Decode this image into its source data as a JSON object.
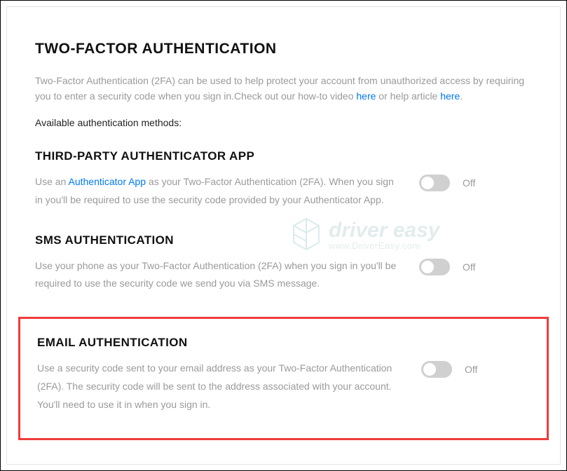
{
  "header": {
    "title": "TWO-FACTOR AUTHENTICATION",
    "intro_part1": "Two-Factor Authentication (2FA) can be used to help protect your account from unauthorized access by requiring you to enter a security code when you sign in.Check out our how-to video ",
    "link_here_1": "here",
    "intro_part2": " or help article ",
    "link_here_2": "here",
    "intro_part3": ".",
    "available": "Available authentication methods:"
  },
  "sections": {
    "authenticator": {
      "title": "THIRD-PARTY AUTHENTICATOR APP",
      "desc_pre": "Use an ",
      "desc_link": "Authenticator App",
      "desc_post": " as your Two-Factor Authentication (2FA). When you sign in you'll be required to use the security code provided by your Authenticator App.",
      "toggle_state": "Off"
    },
    "sms": {
      "title": "SMS AUTHENTICATION",
      "desc": "Use your phone as your Two-Factor Authentication (2FA) when you sign in you'll be required to use the security code we send you via SMS message.",
      "toggle_state": "Off"
    },
    "email": {
      "title": "EMAIL AUTHENTICATION",
      "desc": "Use a security code sent to your email address as your Two-Factor Authentication (2FA). The security code will be sent to the address associated with your account. You'll need to use it in when you sign in.",
      "toggle_state": "Off"
    }
  },
  "watermark": {
    "line1": "driver easy",
    "line2": "www.DriverEasy.com"
  }
}
